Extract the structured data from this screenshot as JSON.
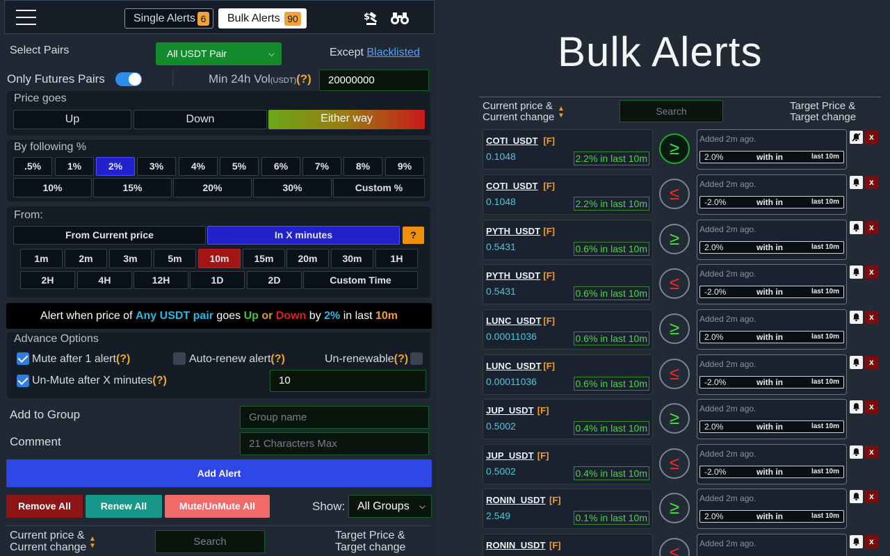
{
  "header": {
    "single_label": "Single Alerts",
    "single_count": "6",
    "bulk_label": "Bulk Alerts",
    "bulk_count": "90"
  },
  "pairs": {
    "label": "Select Pairs",
    "selected": "All USDT Pair",
    "except_label": "Except",
    "except_link": "Blacklisted",
    "futures_label": "Only Futures Pairs",
    "min_vol_label": "Min 24h Vol",
    "min_vol_unit": "(USDT)",
    "help": "(?)",
    "min_vol_value": "20000000"
  },
  "price_goes": {
    "title": "Price goes",
    "options": [
      "Up",
      "Down",
      "Either way"
    ]
  },
  "percent": {
    "title": "By following %",
    "row1": [
      ".5%",
      "1%",
      "2%",
      "3%",
      "4%",
      "5%",
      "6%",
      "7%",
      "8%",
      "9%"
    ],
    "row2": [
      "10%",
      "15%",
      "20%",
      "30%",
      "Custom %"
    ]
  },
  "from": {
    "title": "From:",
    "current": "From Current price",
    "xmin": "In X minutes",
    "help": "?",
    "row1": [
      "1m",
      "2m",
      "3m",
      "5m",
      "10m",
      "15m",
      "20m",
      "30m",
      "1H"
    ],
    "row2": [
      "2H",
      "4H",
      "12H",
      "1D",
      "2D",
      "Custom Time"
    ]
  },
  "summary": {
    "t1": "Alert when price of ",
    "pair": "Any USDT pair",
    "t2": " goes ",
    "up": "Up",
    "or": " or ",
    "down": "Down",
    "t3": " by ",
    "pct": "2%",
    "t4": " in last ",
    "time": "10m"
  },
  "advance": {
    "title": "Advance Options",
    "mute": "Mute after 1 alert",
    "autorenew": "Auto-renew alert",
    "unrenewable": "Un-renewable",
    "unmute": "Un-Mute after X minutes",
    "unmute_value": "10",
    "help": "(?)"
  },
  "group": {
    "label": "Add to Group",
    "placeholder": "Group name"
  },
  "comment": {
    "label": "Comment",
    "placeholder": "21 Characters Max"
  },
  "actions": {
    "add": "Add Alert",
    "remove_all": "Remove All",
    "renew_all": "Renew All",
    "mute_all": "Mute/UnMute All",
    "show_label": "Show:",
    "show_value": "All Groups"
  },
  "list_header": {
    "current_l1": "Current price &",
    "current_l2": "Current change",
    "search": "Search",
    "target_l1": "Target Price &",
    "target_l2": "Target change"
  },
  "right_title": "Bulk Alerts",
  "alerts": [
    {
      "symbol": "COTI_USDT",
      "f": "[F]",
      "price": "0.1048",
      "change": "2.2% in last 10m",
      "dir": "≥",
      "added": "Added 2m ago.",
      "target": "2.0%",
      "within": "with in",
      "last": "last 10m"
    },
    {
      "symbol": "COTI_USDT",
      "f": "[F]",
      "price": "0.1048",
      "change": "2.2% in last 10m",
      "dir": "≤",
      "added": "Added 2m ago.",
      "target": "-2.0%",
      "within": "with in",
      "last": "last 10m"
    },
    {
      "symbol": "PYTH_USDT",
      "f": "[F]",
      "price": "0.5431",
      "change": "0.6% in last 10m",
      "dir": "≥",
      "added": "Added 2m ago.",
      "target": "2.0%",
      "within": "with in",
      "last": "last 10m"
    },
    {
      "symbol": "PYTH_USDT",
      "f": "[F]",
      "price": "0.5431",
      "change": "0.6% in last 10m",
      "dir": "≤",
      "added": "Added 2m ago.",
      "target": "-2.0%",
      "within": "with in",
      "last": "last 10m"
    },
    {
      "symbol": "LUNC_USDT",
      "f": "[F]",
      "price": "0.00011036",
      "change": "0.6% in last 10m",
      "dir": "≥",
      "added": "Added 2m ago.",
      "target": "2.0%",
      "within": "with in",
      "last": "last 10m"
    },
    {
      "symbol": "LUNC_USDT",
      "f": "[F]",
      "price": "0.00011036",
      "change": "0.6% in last 10m",
      "dir": "≤",
      "added": "Added 2m ago.",
      "target": "-2.0%",
      "within": "with in",
      "last": "last 10m"
    },
    {
      "symbol": "JUP_USDT",
      "f": "[F]",
      "price": "0.5002",
      "change": "0.4% in last 10m",
      "dir": "≥",
      "added": "Added 2m ago.",
      "target": "2.0%",
      "within": "with in",
      "last": "last 10m"
    },
    {
      "symbol": "JUP_USDT",
      "f": "[F]",
      "price": "0.5002",
      "change": "0.4% in last 10m",
      "dir": "≤",
      "added": "Added 2m ago.",
      "target": "-2.0%",
      "within": "with in",
      "last": "last 10m"
    },
    {
      "symbol": "RONIN_USDT",
      "f": "[F]",
      "price": "2.549",
      "change": "0.1% in last 10m",
      "dir": "≥",
      "added": "Added 2m ago.",
      "target": "2.0%",
      "within": "with in",
      "last": "last 10m"
    },
    {
      "symbol": "RONIN_USDT",
      "f": "[F]",
      "price": "",
      "change": "",
      "dir": "≤",
      "added": "Added 2m ago.",
      "target": "",
      "within": "",
      "last": ""
    }
  ],
  "icons": {
    "menu": "hamburger-icon",
    "auction": "gavel-dollar-icon",
    "binoculars": "binoculars-icon",
    "sort": "sort-arrows-icon",
    "bell": "bell-slash-icon",
    "close": "close-icon"
  },
  "colors": {
    "accent_green": "#138a2c",
    "blue_active": "#2222cc",
    "red_active": "#a31414",
    "add_button": "#2f47e6",
    "remove_button": "#8e1515",
    "renew_button": "#17968a",
    "mute_button": "#f06a6a"
  }
}
